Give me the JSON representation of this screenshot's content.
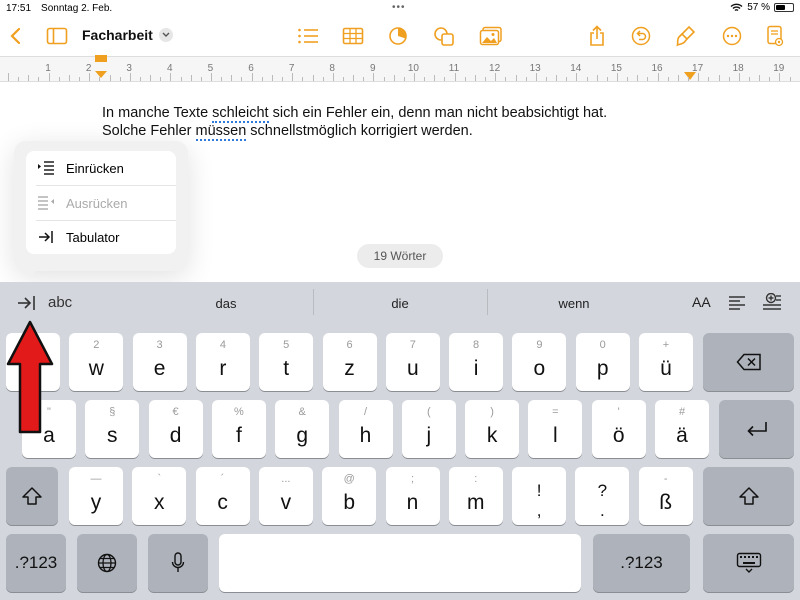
{
  "status": {
    "time": "17:51",
    "date": "Sonntag 2. Feb.",
    "battery": "57 %",
    "battery_level": 0.57
  },
  "toolbar": {
    "title": "Facharbeit",
    "icons": [
      "back-chevron-icon",
      "sidebar-icon",
      "list-icon",
      "table-icon",
      "chart-icon",
      "shapes-icon",
      "media-icon",
      "share-icon",
      "undo-icon",
      "format-brush-icon",
      "more-icon",
      "document-icon"
    ]
  },
  "ruler": {
    "numbers": [
      "1",
      "2",
      "3",
      "4",
      "5",
      "6",
      "7",
      "8",
      "9",
      "10",
      "11",
      "12",
      "13",
      "14",
      "15",
      "16",
      "17",
      "18",
      "19"
    ]
  },
  "document": {
    "line1_a": "In manche Texte ",
    "line1_b": "schleicht",
    "line1_c": " sich ein Fehler ein, denn man nicht beabsichtigt hat.",
    "line2_a": "Solche Fehler ",
    "line2_b": "müssen",
    "line2_c": " schnellstmöglich korrigiert werden."
  },
  "word_count": "19 Wörter",
  "popover": {
    "items": [
      {
        "label": "Einrücken",
        "icon": "indent-icon",
        "enabled": true
      },
      {
        "label": "Ausrücken",
        "icon": "outdent-icon",
        "enabled": false
      },
      {
        "label": "Tabulator",
        "icon": "tab-icon",
        "enabled": true
      }
    ]
  },
  "keyboard": {
    "suggestion_prefix": "abc",
    "suggestions": [
      "das",
      "die",
      "wenn"
    ],
    "text_size_label": "AA",
    "row1": [
      {
        "sub": "1",
        "main": "q"
      },
      {
        "sub": "2",
        "main": "w"
      },
      {
        "sub": "3",
        "main": "e"
      },
      {
        "sub": "4",
        "main": "r"
      },
      {
        "sub": "5",
        "main": "t"
      },
      {
        "sub": "6",
        "main": "z"
      },
      {
        "sub": "7",
        "main": "u"
      },
      {
        "sub": "8",
        "main": "i"
      },
      {
        "sub": "9",
        "main": "o"
      },
      {
        "sub": "0",
        "main": "p"
      },
      {
        "sub": "+",
        "main": "ü"
      }
    ],
    "row2": [
      {
        "sub": "\"",
        "main": "a"
      },
      {
        "sub": "§",
        "main": "s"
      },
      {
        "sub": "€",
        "main": "d"
      },
      {
        "sub": "%",
        "main": "f"
      },
      {
        "sub": "&",
        "main": "g"
      },
      {
        "sub": "/",
        "main": "h"
      },
      {
        "sub": "(",
        "main": "j"
      },
      {
        "sub": ")",
        "main": "k"
      },
      {
        "sub": "=",
        "main": "l"
      },
      {
        "sub": "'",
        "main": "ö"
      },
      {
        "sub": "#",
        "main": "ä"
      }
    ],
    "row3": [
      {
        "sub": "—",
        "main": "y"
      },
      {
        "sub": "`",
        "main": "x"
      },
      {
        "sub": "´",
        "main": "c"
      },
      {
        "sub": "...",
        "main": "v"
      },
      {
        "sub": "@",
        "main": "b"
      },
      {
        "sub": ";",
        "main": "n"
      },
      {
        "sub": ":",
        "main": "m"
      },
      {
        "top": "!",
        "bottom": ","
      },
      {
        "top": "?",
        "bottom": "."
      },
      {
        "sub": "-",
        "main": "ß"
      }
    ],
    "numbers_key": ".?123"
  }
}
